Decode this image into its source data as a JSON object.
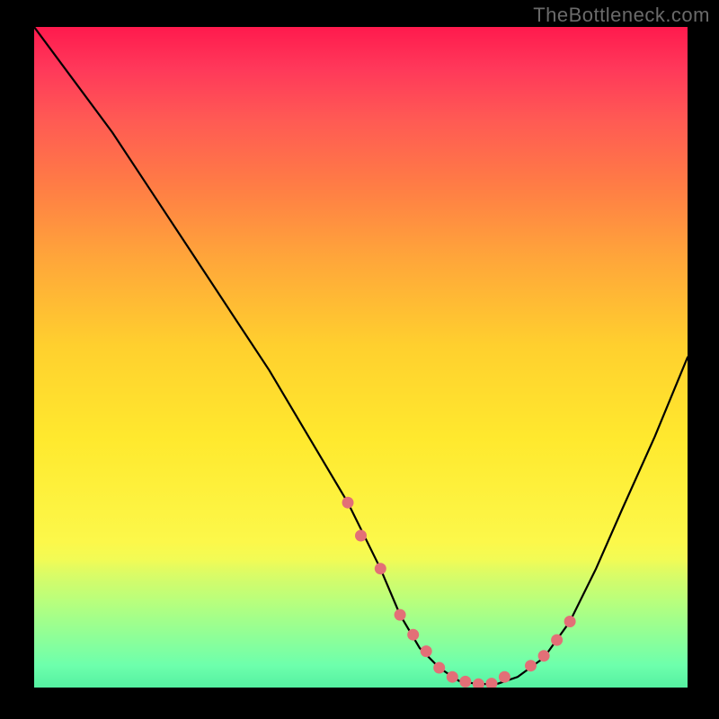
{
  "brand": {
    "watermark": "TheBottleneck.com"
  },
  "chart_data": {
    "type": "line",
    "title": "",
    "xlabel": "",
    "ylabel": "",
    "xlim": [
      0,
      100
    ],
    "ylim": [
      0,
      100
    ],
    "series": [
      {
        "name": "bottleneck-curve",
        "x": [
          0,
          6,
          12,
          18,
          24,
          30,
          36,
          42,
          48,
          53,
          56,
          59,
          62,
          65,
          68,
          71,
          74,
          78,
          82,
          86,
          90,
          95,
          100
        ],
        "y": [
          100,
          92,
          84,
          75,
          66,
          57,
          48,
          38,
          28,
          18,
          11,
          6,
          3,
          1,
          0.5,
          0.6,
          1.6,
          4.5,
          10,
          18,
          27,
          38,
          50
        ]
      }
    ],
    "markers": {
      "name": "highlight-points",
      "x": [
        48,
        50,
        53,
        56,
        58,
        60,
        62,
        64,
        66,
        68,
        70,
        72,
        76,
        78,
        80,
        82
      ],
      "y": [
        28,
        23,
        18,
        11,
        8,
        5.5,
        3,
        1.6,
        0.9,
        0.5,
        0.6,
        1.6,
        3.3,
        4.8,
        7.2,
        10
      ]
    },
    "color_scale": {
      "top": "#ff1a4d",
      "mid": "#ffe92e",
      "bottom": "#55f0a1"
    }
  }
}
